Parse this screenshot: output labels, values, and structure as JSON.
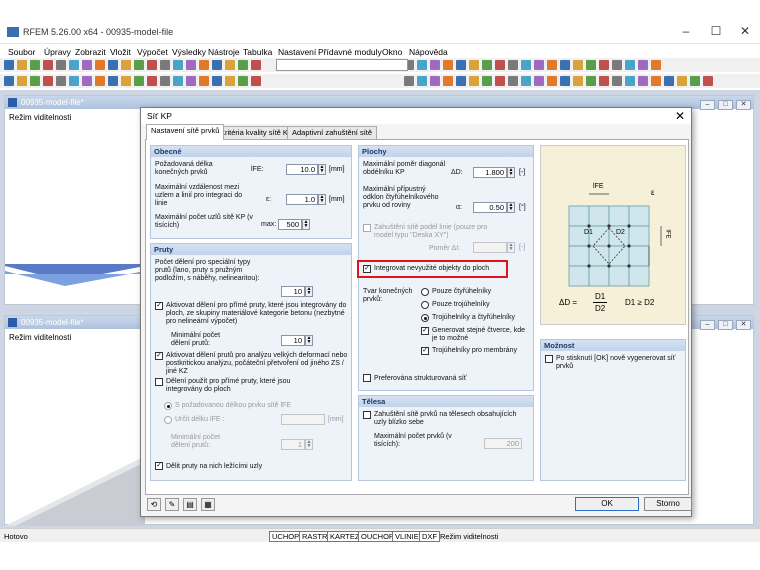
{
  "app": {
    "title": "RFEM 5.26.00 x64 - 00935-model-file"
  },
  "menu": [
    "Soubor",
    "Úpravy",
    "Zobrazit",
    "Vložit",
    "Výpočet",
    "Výsledky",
    "Nástroje",
    "Tabulka",
    "Nastavení",
    "Přídavné moduly",
    "Okno",
    "Nápověda"
  ],
  "windows": [
    {
      "title": "00935-model-file*",
      "label": "Režim viditelnosti"
    },
    {
      "title": "00935-model-file*",
      "label": "Režim viditelnosti"
    }
  ],
  "status": {
    "left": "Hotovo",
    "buttons": [
      "UCHOP",
      "RASTR",
      "KARTEZ",
      "OUCHOP",
      "VLINIE",
      "DXF"
    ],
    "right": "Režim viditelnosti"
  },
  "dialog": {
    "title": "Síť KP",
    "tabs": [
      "Nastavení sítě prvků",
      "Kritéria kvality sítě KP",
      "Adaptivní zahuštění sítě"
    ],
    "obecne": {
      "header": "Obecné",
      "len_label": "Požadovaná délka konečných prvků",
      "len_sym": "lFE:",
      "len_val": "10.0",
      "len_unit": "[mm]",
      "dist_label": "Maximální vzdálenost mezi uzlem a linií pro integraci do linie",
      "dist_sym": "ε:",
      "dist_val": "1.0",
      "dist_unit": "[mm]",
      "nodes_label": "Maximální počet uzlů sítě KP (v tisících)",
      "nodes_sym": "max:",
      "nodes_val": "500"
    },
    "pruty": {
      "header": "Pruty",
      "div_label": "Počet dělení pro speciální typy prutů (lano, pruty s pružným podložím, s náběhy, nelinearitou):",
      "div_val": "10",
      "c1": "Aktivovat dělení pro přímé pruty, které jsou integrovány do ploch, ze skupiny materiálové kategorie betonu (nezbytné pro nelineární výpočet)",
      "min_label": "Minimální počet dělení prutů:",
      "min_val": "10",
      "c2": "Aktivovat dělení prutů pro analýzu velkých deformací nebo postkritickou analýzu, počáteční přetvoření od jiného ZS / jiné KZ",
      "c3": "Dělení použít pro přímé pruty, které jsou integrovány do ploch",
      "r1": "S požadovanou délkou prvku sítě lFE",
      "r2": "Určit délku lFE :",
      "r2_unit": "[mm]",
      "min2_label": "Minimální počet dělení prutů:",
      "min2_val": "1",
      "c4": "Dělit pruty na nich ležícími uzly"
    },
    "plochy": {
      "header": "Plochy",
      "ratio_label": "Maximální poměr diagonál obdélníku KP",
      "ratio_sym": "ΔD:",
      "ratio_val": "1.800",
      "ratio_unit": "[-]",
      "angle_label": "Maximální přípustný odklon čtyřúhelníkového prvku od roviny",
      "angle_sym": "α:",
      "angle_val": "0.50",
      "angle_unit": "[°]",
      "thick_label": "Zahuštění sítě podél linie (pouze pro model typu \"Deska XY\")",
      "ratio2_label": "Poměr ΔI:",
      "ratio2_unit": "[-]",
      "integrate": "Integrovat nevyužité objekty do ploch",
      "shape_label": "Tvar konečných prvků:",
      "shapes": [
        "Pouze čtyřúhelníky",
        "Pouze trojúhelníky",
        "Trojúhelníky a čtyřúhelníky"
      ],
      "same_sq": "Generovat stejné čtverce, kde je to možné",
      "tri_mem": "Trojúhelníky pro membrány",
      "struct": "Preferována strukturovaná síť"
    },
    "telesa": {
      "header": "Tělesa",
      "c1": "Zahuštění sítě prvků na tělesech obsahujících uzly blízko sebe",
      "max_label": "Maximální počet prvků (v tisících):",
      "max_val": "200"
    },
    "moznost": {
      "header": "Možnost",
      "c1": "Po stisknutí [OK] nově vygenerovat síť prvků"
    },
    "figure": {
      "lfe": "lFE",
      "eps": "ε",
      "ld": "lFE",
      "formula_left": "ΔD =",
      "d1": "D1",
      "d2": "D2",
      "rel": "D1 ≥ D2",
      "labels": [
        "D1",
        "D2"
      ]
    },
    "ok": "OK",
    "cancel": "Storno"
  },
  "colors": {
    "accent": "#2b6fd1",
    "highlight": "#e01515"
  }
}
